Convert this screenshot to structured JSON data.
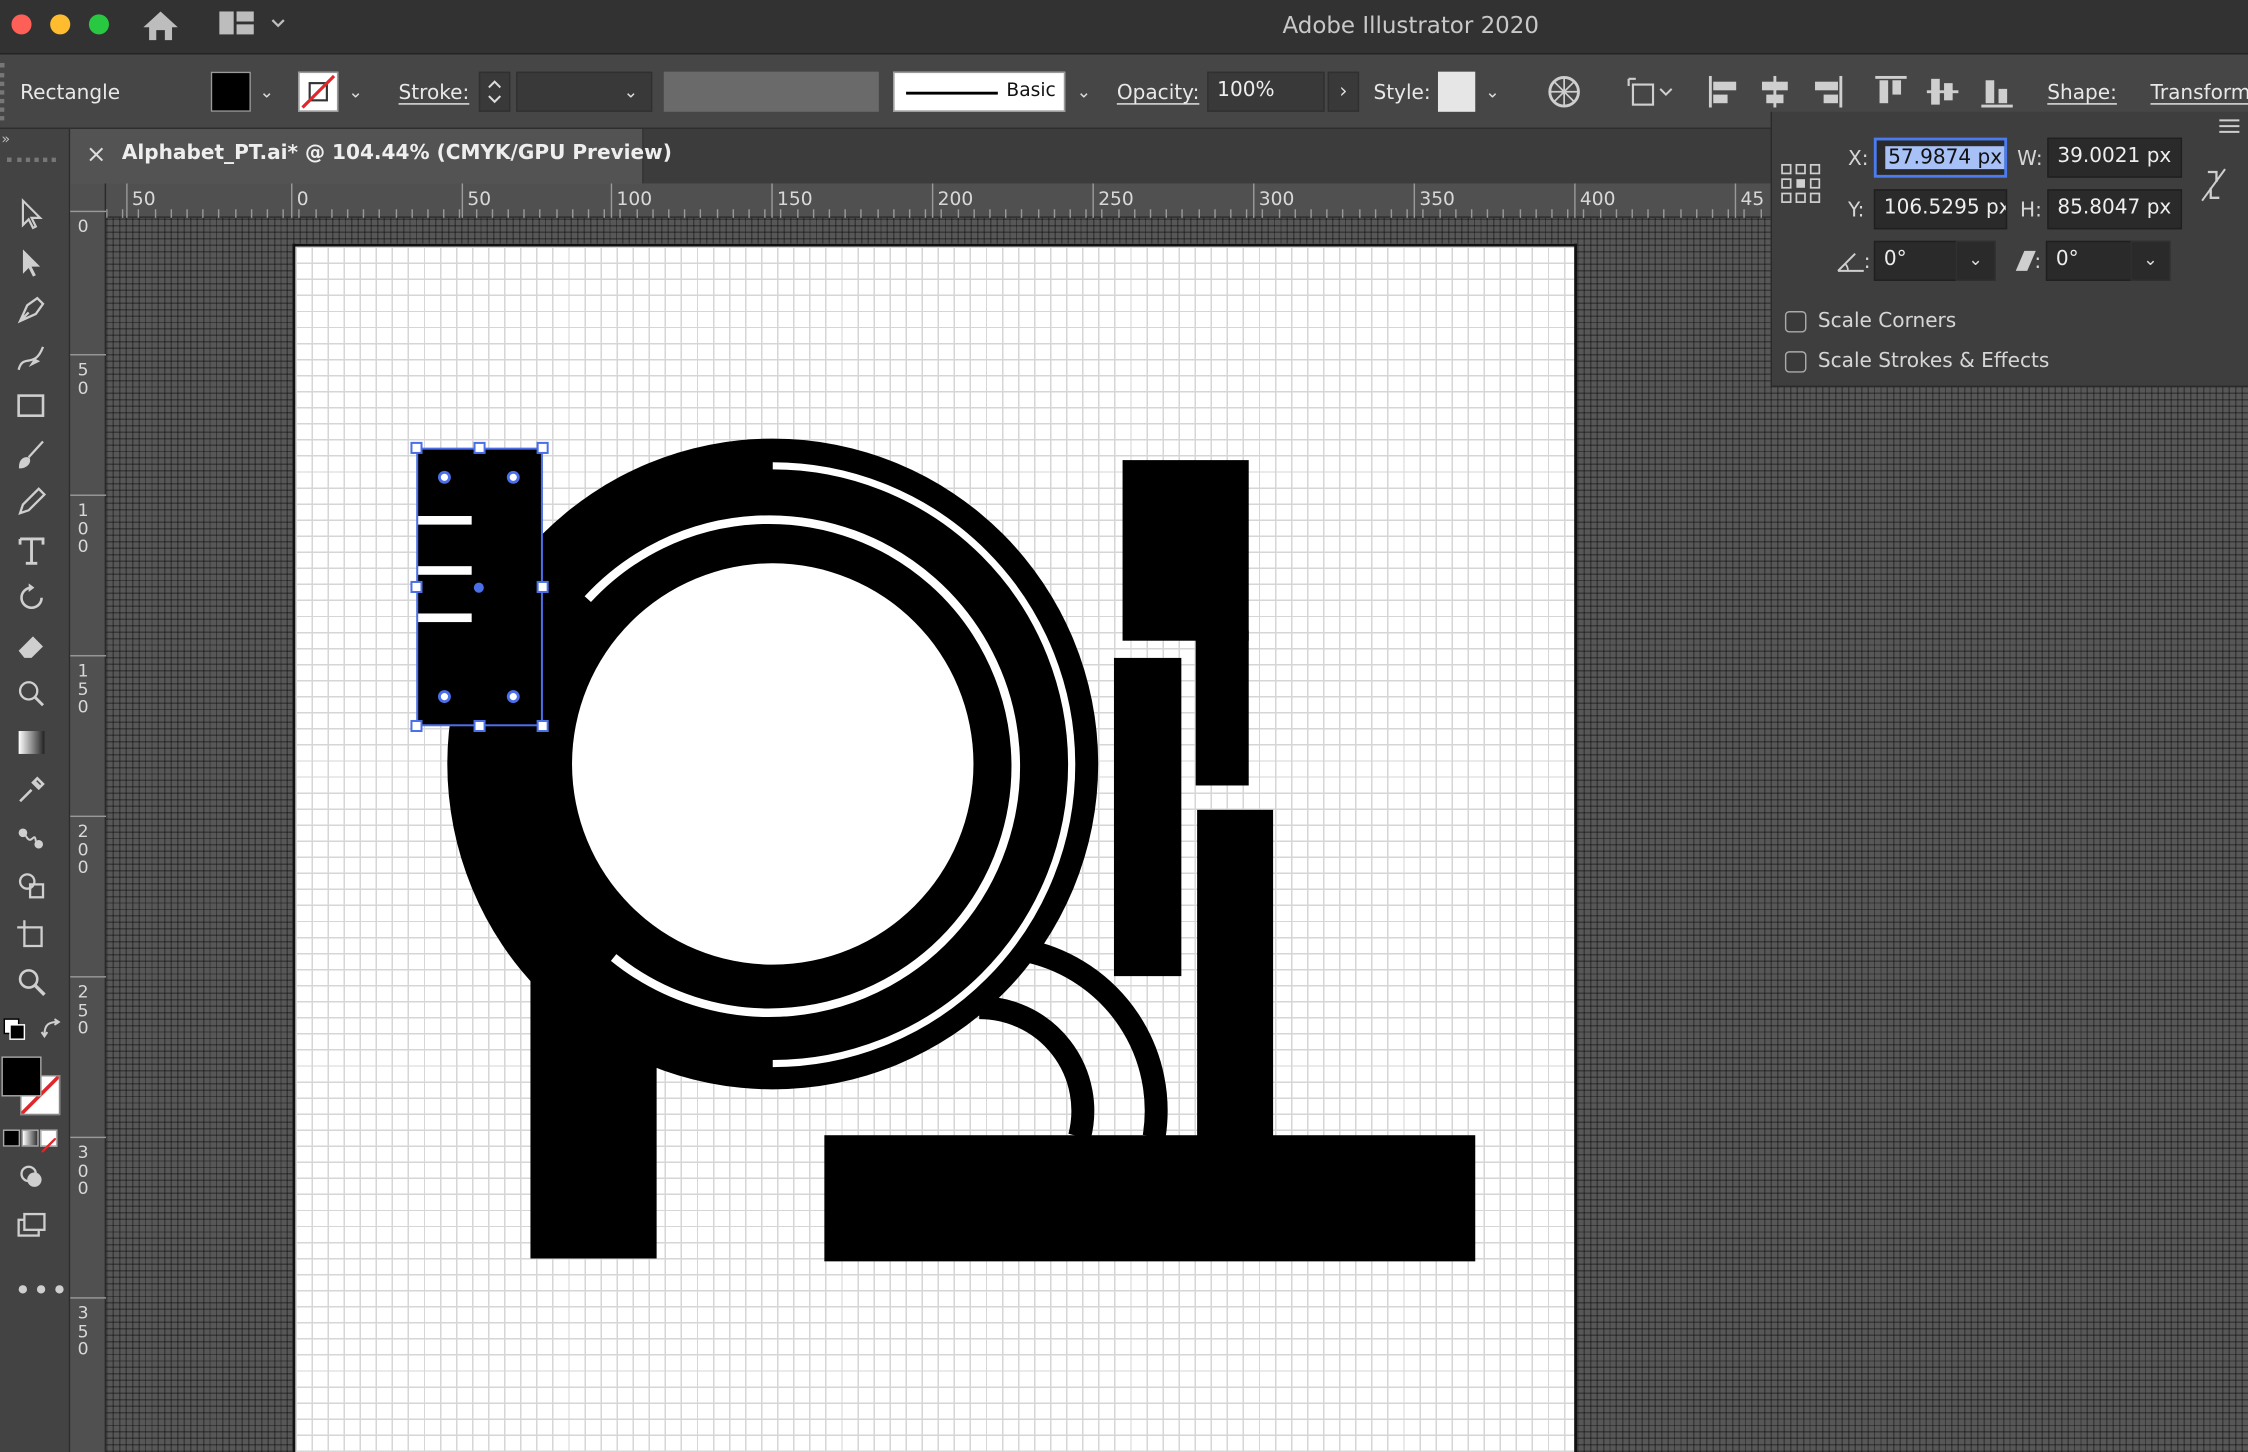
{
  "window": {
    "title": "Adobe Illustrator 2020"
  },
  "controlbar": {
    "selection_type": "Rectangle",
    "stroke_label": "Stroke:",
    "brush_label": "Basic",
    "opacity_label": "Opacity:",
    "opacity_value": "100%",
    "style_label": "Style:",
    "shape_label": "Shape:",
    "transform_label": "Transform"
  },
  "document": {
    "tab_title": "Alphabet_PT.ai* @ 104.44% (CMYK/GPU Preview)",
    "close_glyph": "×"
  },
  "rulers": {
    "horizontal": [
      "50",
      "0",
      "50",
      "100",
      "150",
      "200",
      "250",
      "300",
      "350",
      "400",
      "45"
    ],
    "vertical": [
      "0",
      "50",
      "100",
      "150",
      "200",
      "250",
      "300",
      "350"
    ]
  },
  "transform_panel": {
    "x_label": "X:",
    "x_value": "57.9874 px",
    "y_label": "Y:",
    "y_value": "106.5295 px",
    "w_label": "W:",
    "w_value": "39.0021 px",
    "h_label": "H:",
    "h_value": "85.8047 px",
    "rotate_value": "0°",
    "shear_value": "0°",
    "scale_corners": "Scale Corners",
    "scale_strokes": "Scale Strokes & Effects"
  },
  "colors": {
    "selection": "#4a6fe8",
    "fill": "#000000",
    "chrome_dark": "#323232",
    "chrome_mid": "#464646"
  },
  "icons": [
    "home-icon",
    "workspace-icon",
    "selection-tool-icon",
    "direct-selection-tool-icon",
    "pen-tool-icon",
    "curvature-tool-icon",
    "rectangle-tool-icon",
    "paintbrush-tool-icon",
    "pencil-tool-icon",
    "type-tool-icon",
    "rotate-tool-icon",
    "eraser-tool-icon",
    "warp-tool-icon",
    "gradient-tool-icon",
    "eyedropper-tool-icon",
    "blend-tool-icon",
    "shape-builder-tool-icon",
    "artboard-tool-icon",
    "zoom-tool-icon",
    "more-tools-icon"
  ]
}
